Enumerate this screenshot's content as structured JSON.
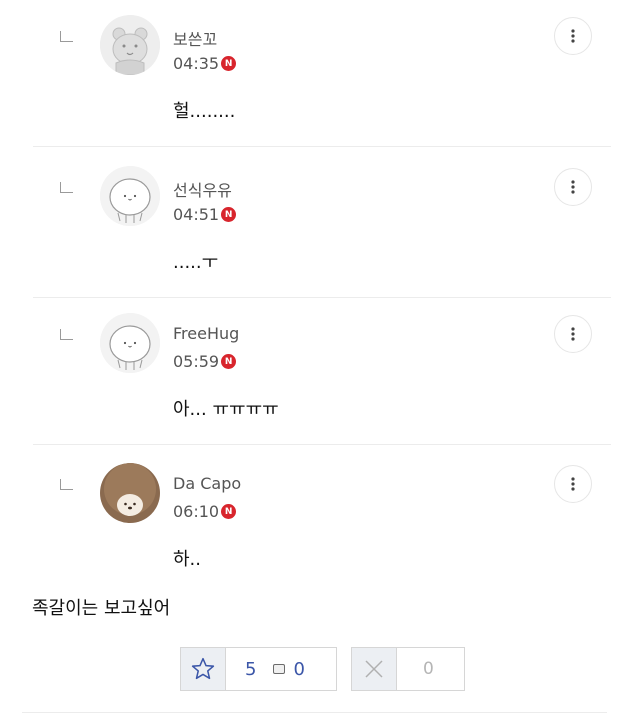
{
  "comments": [
    {
      "nickname": "보쓴꼬",
      "time": "04:35",
      "new_badge": "N",
      "text": "헐........",
      "avatar": "bear-avatar-icon"
    },
    {
      "nickname": "선식우유",
      "time": "04:51",
      "new_badge": "N",
      "text": ".....ㅜ",
      "avatar": "blob-avatar-icon"
    },
    {
      "nickname": "FreeHug",
      "time": "05:59",
      "new_badge": "N",
      "text": "아... ㅠㅠㅠㅠ",
      "avatar": "blob-avatar-icon"
    },
    {
      "nickname": "Da Capo",
      "time": "06:10",
      "new_badge": "N",
      "text": "하..",
      "avatar": "hedgehog-avatar-icon"
    }
  ],
  "post_text": "족갈이는 보고싶어",
  "votes": {
    "recommend_count": "5",
    "comment_count": "0",
    "not_recommend_count": "0"
  },
  "colors": {
    "new_badge": "#d8252d",
    "count_blue": "#3b56a8"
  }
}
